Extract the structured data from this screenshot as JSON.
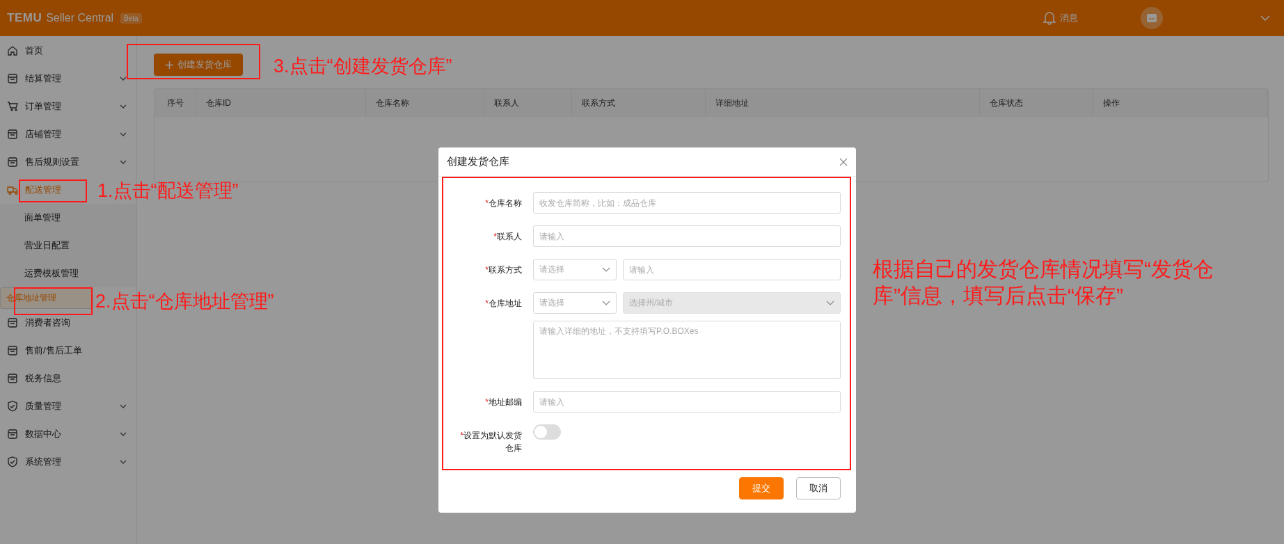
{
  "header": {
    "logo": "TEMU",
    "product": "Seller Central",
    "badge": "Beta",
    "messages": "消息"
  },
  "sidebar": {
    "items": [
      {
        "label": "首页",
        "expandable": false,
        "active": false
      },
      {
        "label": "结算管理",
        "expandable": true,
        "active": false,
        "expanded": false
      },
      {
        "label": "订单管理",
        "expandable": true,
        "active": false,
        "expanded": false
      },
      {
        "label": "店铺管理",
        "expandable": true,
        "active": false,
        "expanded": false
      },
      {
        "label": "售后规则设置",
        "expandable": true,
        "active": false,
        "expanded": false
      },
      {
        "label": "配送管理",
        "expandable": true,
        "active": true,
        "expanded": true,
        "children": [
          {
            "label": "面单管理",
            "selected": false
          },
          {
            "label": "营业日配置",
            "selected": false
          },
          {
            "label": "运费模板管理",
            "selected": false
          },
          {
            "label": "仓库地址管理",
            "selected": true
          }
        ]
      },
      {
        "label": "消费者咨询",
        "expandable": false,
        "active": false
      },
      {
        "label": "售前/售后工单",
        "expandable": false,
        "active": false
      },
      {
        "label": "税务信息",
        "expandable": false,
        "active": false
      },
      {
        "label": "质量管理",
        "expandable": true,
        "active": false,
        "expanded": false
      },
      {
        "label": "数据中心",
        "expandable": true,
        "active": false,
        "expanded": false
      },
      {
        "label": "系统管理",
        "expandable": true,
        "active": false,
        "expanded": false
      }
    ]
  },
  "toolbar": {
    "create_button": "创建发货仓库"
  },
  "table": {
    "columns": [
      "序号",
      "仓库ID",
      "仓库名称",
      "联系人",
      "联系方式",
      "详细地址",
      "仓库状态",
      "操作"
    ]
  },
  "dialog": {
    "title": "创建发货仓库",
    "fields": [
      {
        "kind": "text",
        "label": "仓库名称",
        "required": true,
        "required_mark": "*",
        "placeholder": "收发仓库简称，比如：成品仓库"
      },
      {
        "kind": "text",
        "label": "联系人",
        "required": true,
        "required_mark": "*",
        "placeholder": "请输入"
      },
      {
        "kind": "select-text",
        "label": "联系方式",
        "required": true,
        "required_mark": "*",
        "select": {
          "placeholder": "请选择"
        },
        "input": {
          "placeholder": "请输入"
        }
      },
      {
        "kind": "address",
        "label": "仓库地址",
        "required": true,
        "required_mark": "*",
        "select": {
          "placeholder": "请选择"
        },
        "region": {
          "placeholder": "选择州/城市",
          "disabled": true
        },
        "detail": {
          "placeholder": "请输入详细的地址，不支持填写P.O.BOXes"
        }
      },
      {
        "kind": "text",
        "label": "地址邮编",
        "required": true,
        "required_mark": "*",
        "placeholder": "请输入"
      },
      {
        "kind": "switch",
        "label": "设置为默认发货仓库",
        "required": true,
        "required_mark": "*",
        "on": false
      }
    ],
    "buttons": [
      {
        "label": "提交",
        "primary": true
      },
      {
        "label": "取消",
        "primary": false
      }
    ]
  },
  "annotations": [
    {
      "kind": "step-1",
      "text": "1.点击“配送管理”"
    },
    {
      "kind": "step-2",
      "text": "2.点击“仓库地址管理”"
    },
    {
      "kind": "step-3",
      "text": "3.点击“创建发货仓库”"
    },
    {
      "kind": "note",
      "text": "根据自己的发货仓库情况填写“发货仓库”信息，填写后点击“保存”"
    }
  ]
}
